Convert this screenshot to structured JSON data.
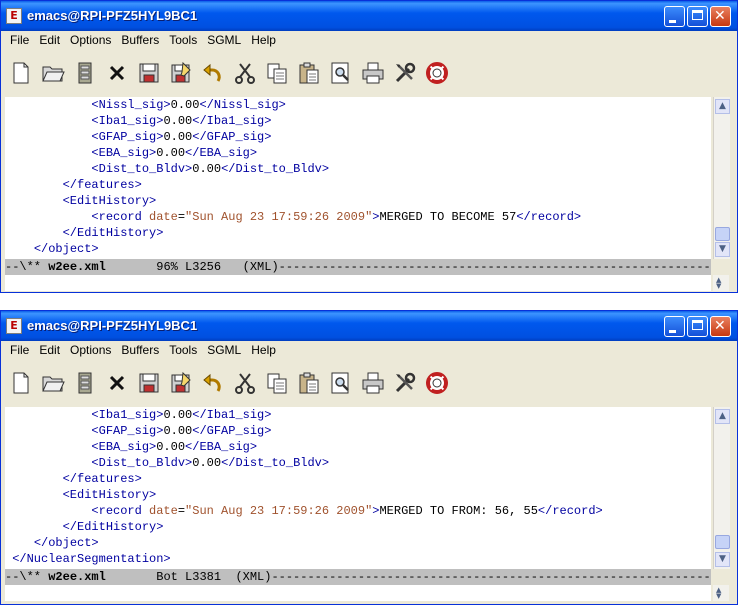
{
  "windows": [
    {
      "title": "emacs@RPI-PFZ5HYL9BC1",
      "menu": [
        "File",
        "Edit",
        "Options",
        "Buffers",
        "Tools",
        "SGML",
        "Help"
      ],
      "lines": [
        [
          {
            "t": "            "
          },
          {
            "c": "tag",
            "t": "<Nissl_sig>"
          },
          {
            "t": "0.00"
          },
          {
            "c": "tag",
            "t": "</Nissl_sig>"
          }
        ],
        [
          {
            "t": "            "
          },
          {
            "c": "tag",
            "t": "<Iba1_sig>"
          },
          {
            "t": "0.00"
          },
          {
            "c": "tag",
            "t": "</Iba1_sig>"
          }
        ],
        [
          {
            "t": "            "
          },
          {
            "c": "tag",
            "t": "<GFAP_sig>"
          },
          {
            "t": "0.00"
          },
          {
            "c": "tag",
            "t": "</GFAP_sig>"
          }
        ],
        [
          {
            "t": "            "
          },
          {
            "c": "tag",
            "t": "<EBA_sig>"
          },
          {
            "t": "0.00"
          },
          {
            "c": "tag",
            "t": "</EBA_sig>"
          }
        ],
        [
          {
            "t": "            "
          },
          {
            "c": "tag",
            "t": "<Dist_to_Bldv>"
          },
          {
            "t": "0.00"
          },
          {
            "c": "tag",
            "t": "</Dist_to_Bldv>"
          }
        ],
        [
          {
            "t": "        "
          },
          {
            "c": "tag",
            "t": "</features>"
          }
        ],
        [
          {
            "t": "        "
          },
          {
            "c": "tag",
            "t": "<EditHistory>"
          }
        ],
        [
          {
            "t": "            "
          },
          {
            "c": "tag",
            "t": "<record "
          },
          {
            "c": "attr",
            "t": "date"
          },
          {
            "t": "="
          },
          {
            "c": "str",
            "t": "\"Sun Aug 23 17:59:26 2009\""
          },
          {
            "c": "tag",
            "t": ">"
          },
          {
            "t": "MERGED TO BECOME 57"
          },
          {
            "c": "tag",
            "t": "</record>"
          }
        ],
        [
          {
            "t": "        "
          },
          {
            "c": "tag",
            "t": "</EditHistory>"
          }
        ],
        [
          {
            "t": "    "
          },
          {
            "c": "tag",
            "t": "</object>"
          }
        ]
      ],
      "modeline": {
        "prefix": "--\\** ",
        "buffer": "w2ee.xml",
        "rest": "       96% L3256   (XML)---------------------------------------------------------------------------"
      }
    },
    {
      "title": "emacs@RPI-PFZ5HYL9BC1",
      "menu": [
        "File",
        "Edit",
        "Options",
        "Buffers",
        "Tools",
        "SGML",
        "Help"
      ],
      "lines": [
        [
          {
            "t": "            "
          },
          {
            "c": "tag",
            "t": "<Iba1_sig>"
          },
          {
            "t": "0.00"
          },
          {
            "c": "tag",
            "t": "</Iba1_sig>"
          }
        ],
        [
          {
            "t": "            "
          },
          {
            "c": "tag",
            "t": "<GFAP_sig>"
          },
          {
            "t": "0.00"
          },
          {
            "c": "tag",
            "t": "</GFAP_sig>"
          }
        ],
        [
          {
            "t": "            "
          },
          {
            "c": "tag",
            "t": "<EBA_sig>"
          },
          {
            "t": "0.00"
          },
          {
            "c": "tag",
            "t": "</EBA_sig>"
          }
        ],
        [
          {
            "t": "            "
          },
          {
            "c": "tag",
            "t": "<Dist_to_Bldv>"
          },
          {
            "t": "0.00"
          },
          {
            "c": "tag",
            "t": "</Dist_to_Bldv>"
          }
        ],
        [
          {
            "t": "        "
          },
          {
            "c": "tag",
            "t": "</features>"
          }
        ],
        [
          {
            "t": "        "
          },
          {
            "c": "tag",
            "t": "<EditHistory>"
          }
        ],
        [
          {
            "t": "            "
          },
          {
            "c": "tag",
            "t": "<record "
          },
          {
            "c": "attr",
            "t": "date"
          },
          {
            "t": "="
          },
          {
            "c": "str",
            "t": "\"Sun Aug 23 17:59:26 2009\""
          },
          {
            "c": "tag",
            "t": ">"
          },
          {
            "t": "MERGED TO FROM: 56, 55"
          },
          {
            "c": "tag",
            "t": "</record>"
          }
        ],
        [
          {
            "t": "        "
          },
          {
            "c": "tag",
            "t": "</EditHistory>"
          }
        ],
        [
          {
            "t": "    "
          },
          {
            "c": "tag",
            "t": "</object>"
          }
        ],
        [
          {
            "t": " "
          },
          {
            "c": "tag",
            "t": "</NuclearSegmentation>"
          }
        ]
      ],
      "modeline": {
        "prefix": "--\\** ",
        "buffer": "w2ee.xml",
        "rest": "       Bot L3381  (XML)---------------------------------------------------------------------------"
      }
    }
  ],
  "toolbar_icons": [
    "new-file-icon",
    "open-folder-icon",
    "dired-icon",
    "close-buffer-icon",
    "save-icon",
    "save-as-icon",
    "undo-icon",
    "cut-icon",
    "copy-icon",
    "paste-icon",
    "search-icon",
    "print-icon",
    "preferences-icon",
    "help-icon"
  ]
}
